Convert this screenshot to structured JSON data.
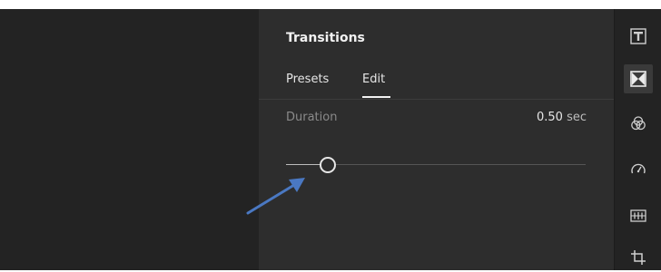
{
  "panel": {
    "title": "Transitions",
    "tabs": [
      {
        "label": "Presets",
        "active": false
      },
      {
        "label": "Edit",
        "active": true
      }
    ]
  },
  "duration": {
    "label": "Duration",
    "value": "0.50",
    "unit": "sec",
    "slider_fraction": 0.14
  },
  "rail": {
    "icons": [
      {
        "name": "text-icon",
        "active": false
      },
      {
        "name": "transitions-icon",
        "active": true
      },
      {
        "name": "color-wheels-icon",
        "active": false
      },
      {
        "name": "speed-gauge-icon",
        "active": false
      },
      {
        "name": "audio-track-icon",
        "active": false
      },
      {
        "name": "crop-icon",
        "active": false
      }
    ]
  },
  "colors": {
    "background": "#232323",
    "panel": "#2d2d2d",
    "text": "#e6e6e6",
    "muted": "#8a8a8a",
    "annotation_arrow": "#4a78c2"
  }
}
